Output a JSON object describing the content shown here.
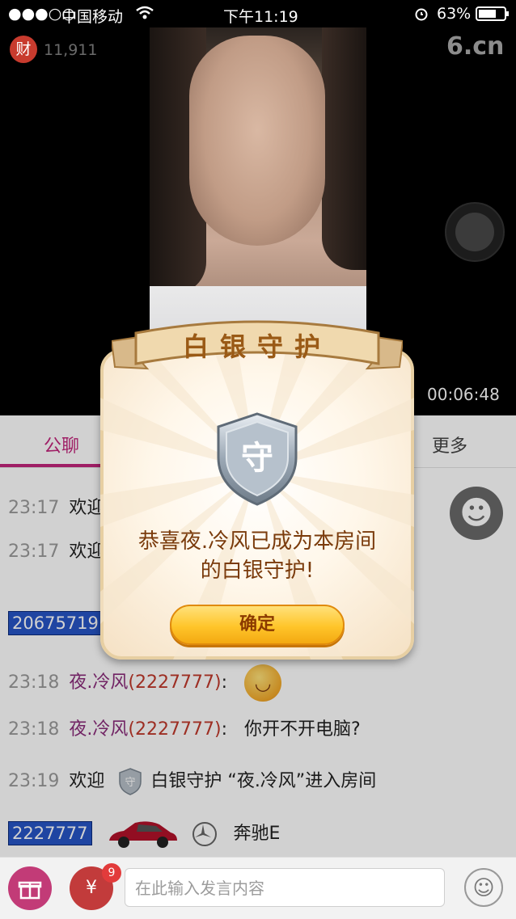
{
  "status_bar": {
    "signal": "●●●○○",
    "carrier": "中国移动",
    "time": "下午11:19",
    "battery": "63%"
  },
  "video": {
    "wealth_badge": "财",
    "fans_count": "11,911",
    "site_logo": "6.cn",
    "elapsed": "00:06:48"
  },
  "tabs": {
    "public_chat": "公聊",
    "more": "更多"
  },
  "chat": {
    "rows": [
      {
        "time": "23:17",
        "text": "欢迎"
      },
      {
        "time": "23:17",
        "text": "欢迎"
      },
      {
        "id_box": "20675719"
      },
      {
        "time": "23:18",
        "user": "夜.冷风",
        "uid": "(2227777)",
        "sep": ":"
      },
      {
        "time": "23:18",
        "user": "夜.冷风",
        "uid": "(2227777)",
        "sep": ":",
        "text": "你开不开电脑?"
      },
      {
        "time": "23:19",
        "prefix": "欢迎",
        "text": "白银守护 “夜.冷风”进入房间"
      },
      {
        "id_box": "2227777",
        "text": "奔驰E"
      }
    ]
  },
  "modal": {
    "title": "白银守护",
    "shield_char": "守",
    "message_line1": "恭喜夜.冷风已成为本房间",
    "message_line2": "的白银守护!",
    "confirm_label": "确定"
  },
  "bottom_bar": {
    "gift_icon": "gift-icon",
    "red_packet_symbol": "¥",
    "red_packet_count": "9",
    "input_placeholder": "在此输入发言内容"
  },
  "colors": {
    "accent": "#c2257c",
    "username": "#8a2b7a",
    "uid": "#c0392b",
    "id_box": "#2755c6",
    "button_gold": "#ffc52a"
  }
}
